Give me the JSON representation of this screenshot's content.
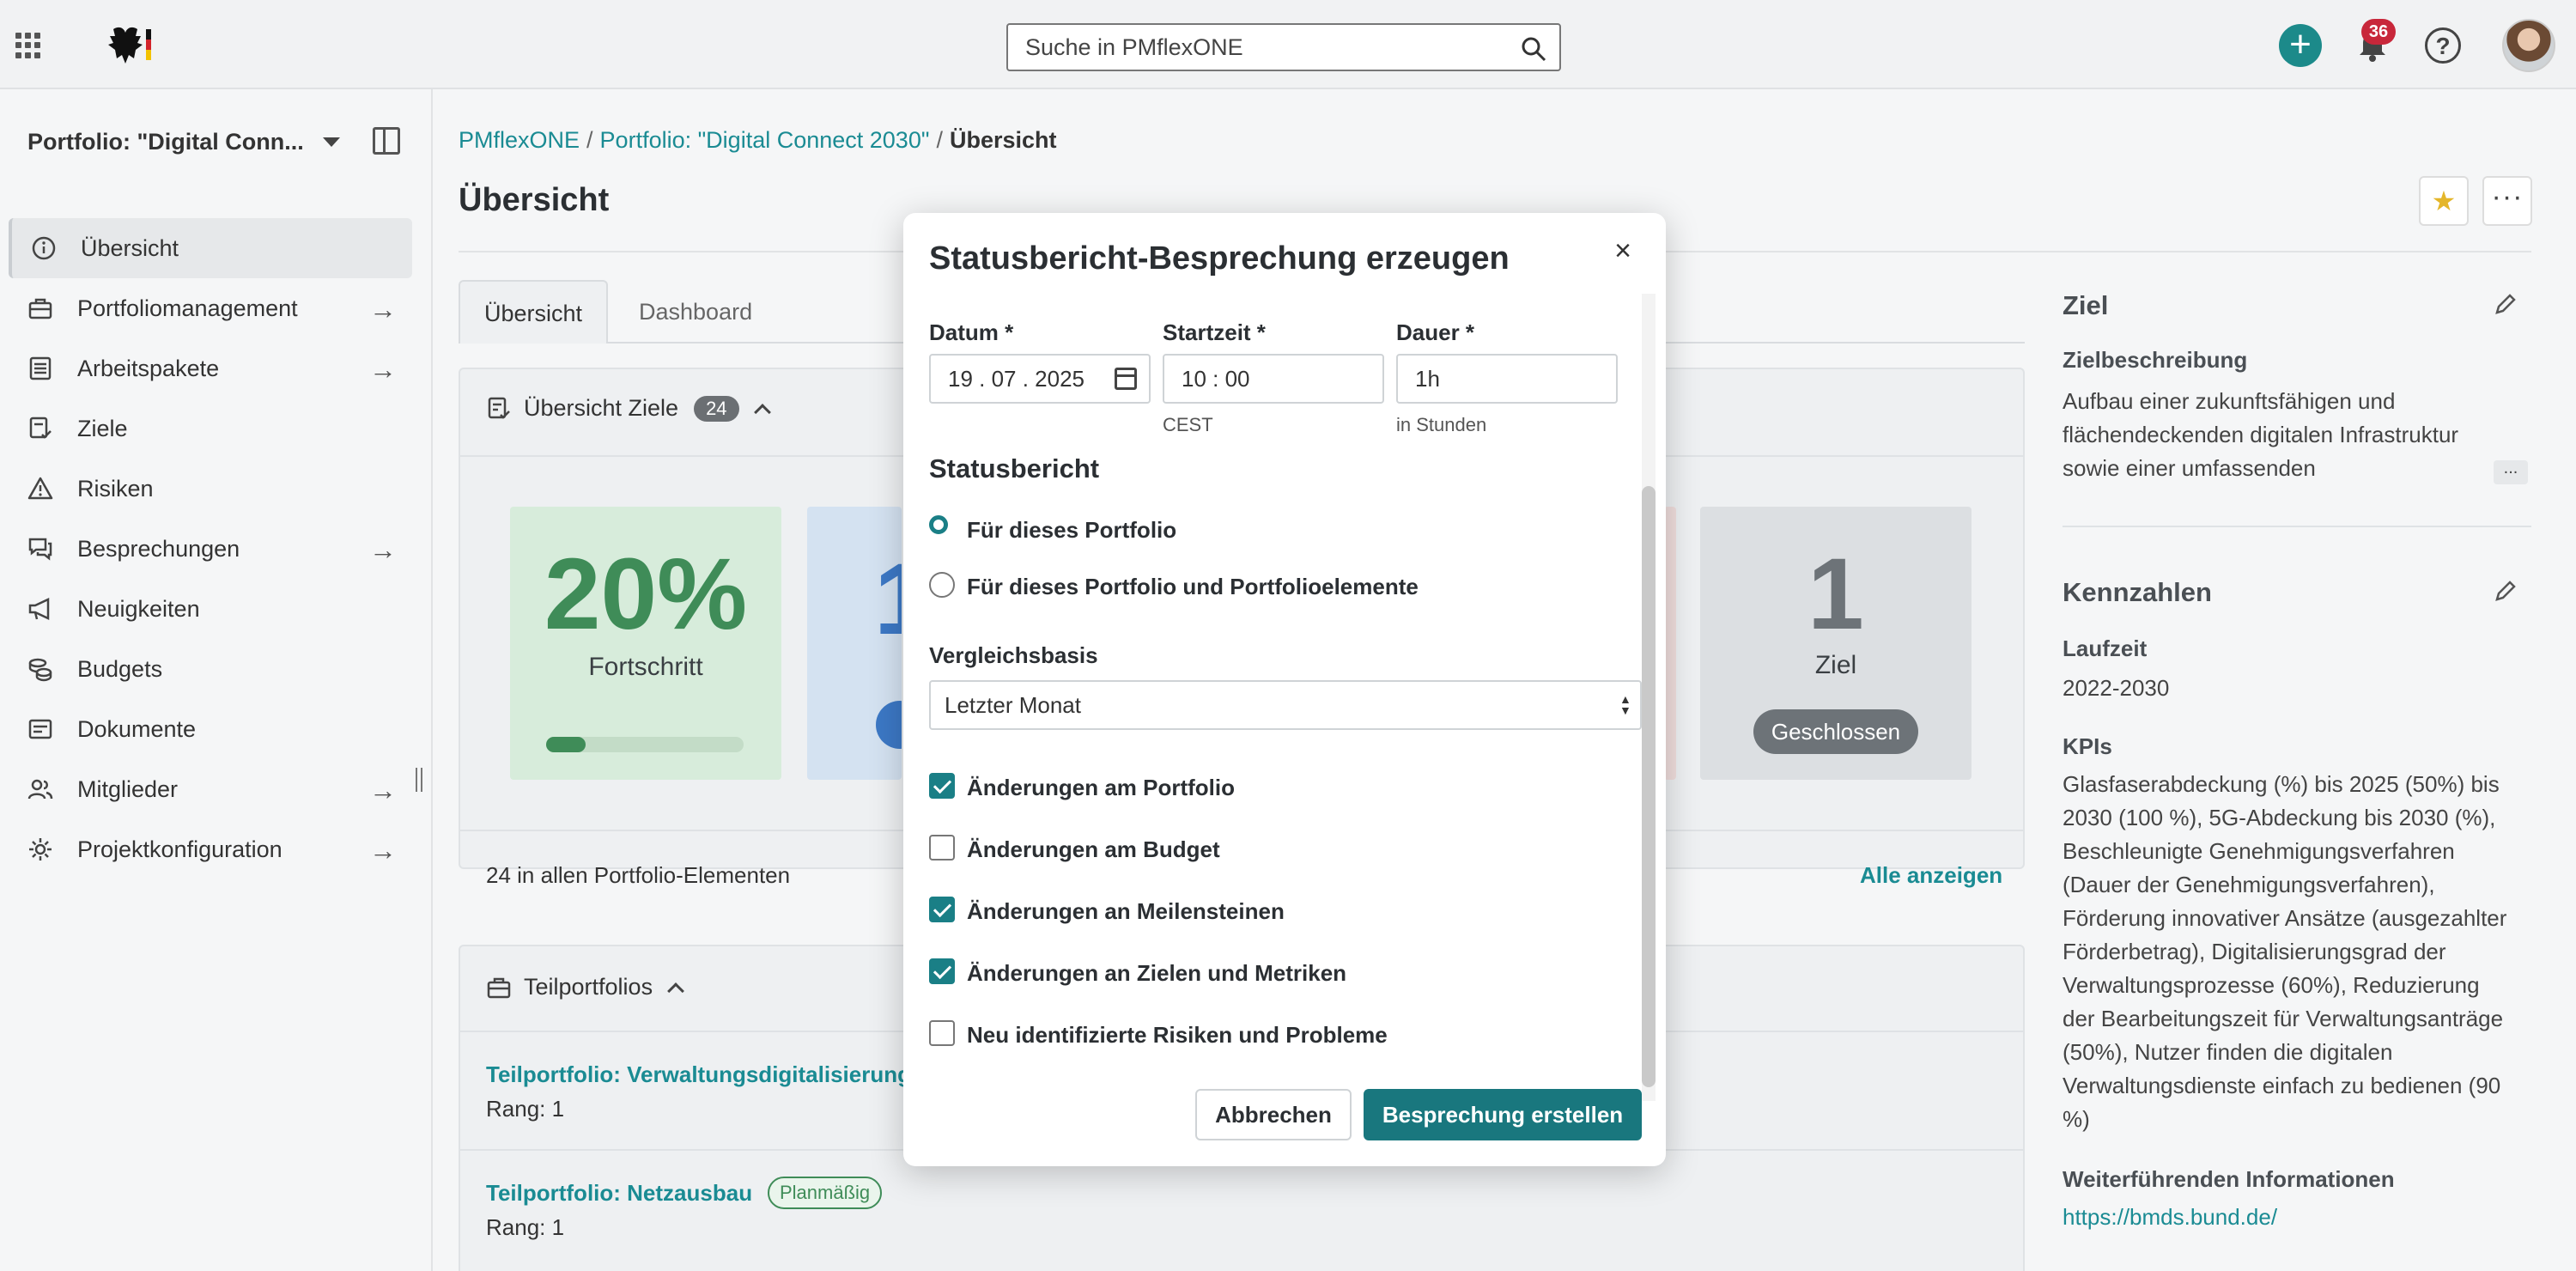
{
  "search": {
    "placeholder": "Suche in PMflexONE"
  },
  "notifications": {
    "count": "36"
  },
  "colors": {
    "accent": "#1a8b93",
    "primary_button": "#19777e",
    "badge_red": "#c8273a",
    "progress_green": "#3f8c58",
    "kpi_blue": "#3c78c5"
  },
  "icons": {
    "apps": "grid-icon",
    "search": "search-icon",
    "add": "plus-icon",
    "notifications": "bell-icon",
    "help": "question-icon",
    "favorite": "star-icon",
    "more": "more-icon",
    "close": "close-icon",
    "edit": "pencil-icon",
    "calendar": "calendar-icon"
  },
  "sidebar": {
    "portfolio_label": "Portfolio: \"Digital Conn...",
    "items": [
      {
        "label": "Übersicht",
        "icon": "info-icon",
        "active": true,
        "arrow": false
      },
      {
        "label": "Portfoliomanagement",
        "icon": "briefcase-icon",
        "active": false,
        "arrow": true
      },
      {
        "label": "Arbeitspakete",
        "icon": "list-icon",
        "active": false,
        "arrow": true
      },
      {
        "label": "Ziele",
        "icon": "goal-icon",
        "active": false,
        "arrow": false
      },
      {
        "label": "Risiken",
        "icon": "warning-icon",
        "active": false,
        "arrow": false
      },
      {
        "label": "Besprechungen",
        "icon": "chat-icon",
        "active": false,
        "arrow": true
      },
      {
        "label": "Neuigkeiten",
        "icon": "megaphone-icon",
        "active": false,
        "arrow": false
      },
      {
        "label": "Budgets",
        "icon": "coins-icon",
        "active": false,
        "arrow": false
      },
      {
        "label": "Dokumente",
        "icon": "document-icon",
        "active": false,
        "arrow": false
      },
      {
        "label": "Mitglieder",
        "icon": "users-icon",
        "active": false,
        "arrow": true
      },
      {
        "label": "Projektkonfiguration",
        "icon": "gear-icon",
        "active": false,
        "arrow": true
      }
    ]
  },
  "breadcrumb": {
    "items": [
      "PMflexONE",
      "Portfolio: \"Digital Connect 2030\""
    ],
    "current": "Übersicht"
  },
  "main": {
    "title": "Übersicht",
    "tabs": [
      "Übersicht",
      "Dashboard"
    ],
    "goals_card": {
      "title": "Übersicht Ziele",
      "count": "24",
      "progress_pct": "20%",
      "progress_label": "Fortschritt",
      "progress_value": 0.2,
      "blue_number": "1",
      "gray_number": "1",
      "gray_label": "Ziel",
      "gray_status": "Geschlossen",
      "footer_text": "24 in allen Portfolio-Elementen",
      "footer_link": "Alle anzeigen"
    },
    "subportfolios": {
      "title": "Teilportfolios",
      "items": [
        {
          "name": "Teilportfolio: Verwaltungsdigitalisierung",
          "rank": "Rang: 1",
          "badge": ""
        },
        {
          "name": "Teilportfolio: Netzausbau",
          "rank": "Rang: 1",
          "badge": "Planmäßig"
        }
      ]
    }
  },
  "right_panel": {
    "goal": {
      "title": "Ziel",
      "description_label": "Zielbeschreibung",
      "description_lines": [
        "Aufbau einer zukunftsfähigen und",
        "flächendeckenden digitalen Infrastruktur",
        "sowie einer umfassenden"
      ],
      "more": "..."
    },
    "kpis": {
      "title": "Kennzahlen",
      "runtime_label": "Laufzeit",
      "runtime": "2022-2030",
      "kpi_label": "KPIs",
      "kpi_lines": [
        "Glasfaserabdeckung (%) bis 2025 (50%) bis",
        "2030 (100 %), 5G-Abdeckung bis 2030 (%),",
        "Beschleunigte Genehmigungsverfahren",
        "(Dauer der Genehmigungsverfahren),",
        "Förderung innovativer Ansätze (ausgezahlter",
        "Förderbetrag), Digitalisierungsgrad der",
        "Verwaltungsprozesse (60%), Reduzierung",
        "der Bearbeitungszeit für Verwaltungsanträge",
        "(50%), Nutzer finden die digitalen",
        "Verwaltungsdienste einfach zu bedienen (90",
        "%)"
      ],
      "info_label": "Weiterführenden Informationen",
      "info_link": "https://bmds.bund.de/"
    }
  },
  "modal": {
    "title": "Statusbericht-Besprechung erzeugen",
    "date_label": "Datum *",
    "date_value": "19 . 07 . 2025",
    "start_label": "Startzeit *",
    "start_value": "10 : 00",
    "start_hint": "CEST",
    "duration_label": "Dauer *",
    "duration_value": "1h",
    "duration_hint": "in Stunden",
    "report_section": "Statusbericht",
    "report_options": [
      {
        "label": "Für dieses Portfolio",
        "checked": true
      },
      {
        "label": "Für dieses Portfolio und Portfolioelemente",
        "checked": false
      }
    ],
    "baseline_label": "Vergleichsbasis",
    "baseline_value": "Letzter Monat",
    "checkboxes": [
      {
        "label": "Änderungen am Portfolio",
        "checked": true
      },
      {
        "label": "Änderungen am Budget",
        "checked": false
      },
      {
        "label": "Änderungen an Meilensteinen",
        "checked": true
      },
      {
        "label": "Änderungen an Zielen und Metriken",
        "checked": true
      },
      {
        "label": "Neu identifizierte Risiken und Probleme",
        "checked": false
      }
    ],
    "cancel_label": "Abbrechen",
    "submit_label": "Besprechung erstellen"
  }
}
